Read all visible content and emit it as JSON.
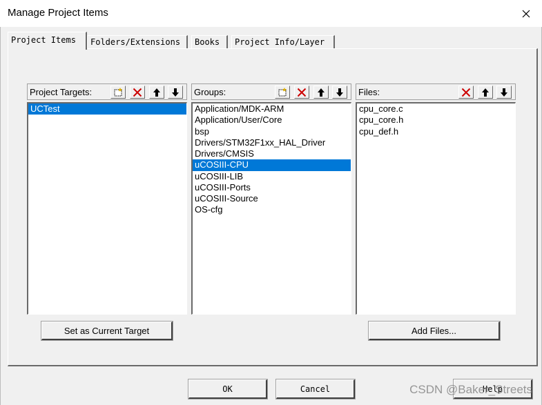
{
  "window": {
    "title": "Manage Project Items"
  },
  "tabs": [
    {
      "label": "Project Items",
      "active": true
    },
    {
      "label": "Folders/Extensions",
      "active": false
    },
    {
      "label": "Books",
      "active": false
    },
    {
      "label": "Project Info/Layer",
      "active": false
    }
  ],
  "targets": {
    "label": "Project Targets:",
    "items": [
      "UCTest"
    ],
    "selected_index": 0
  },
  "groups": {
    "label": "Groups:",
    "items": [
      "Application/MDK-ARM",
      "Application/User/Core",
      "bsp",
      "Drivers/STM32F1xx_HAL_Driver",
      "Drivers/CMSIS",
      "uCOSIII-CPU",
      "uCOSIII-LIB",
      "uCOSIII-Ports",
      "uCOSIII-Source",
      "OS-cfg"
    ],
    "selected_index": 5
  },
  "files": {
    "label": "Files:",
    "items": [
      "cpu_core.c",
      "cpu_core.h",
      "cpu_def.h"
    ]
  },
  "buttons": {
    "set_current_target": "Set as Current Target",
    "add_files": "Add Files...",
    "ok": "OK",
    "cancel": "Cancel",
    "help": "Help"
  },
  "watermark": "CSDN @Baker_Streets",
  "colors": {
    "selection": "#0078d7",
    "dialog_bg": "#f0f0f0",
    "delete_icon": "#cc0000"
  }
}
